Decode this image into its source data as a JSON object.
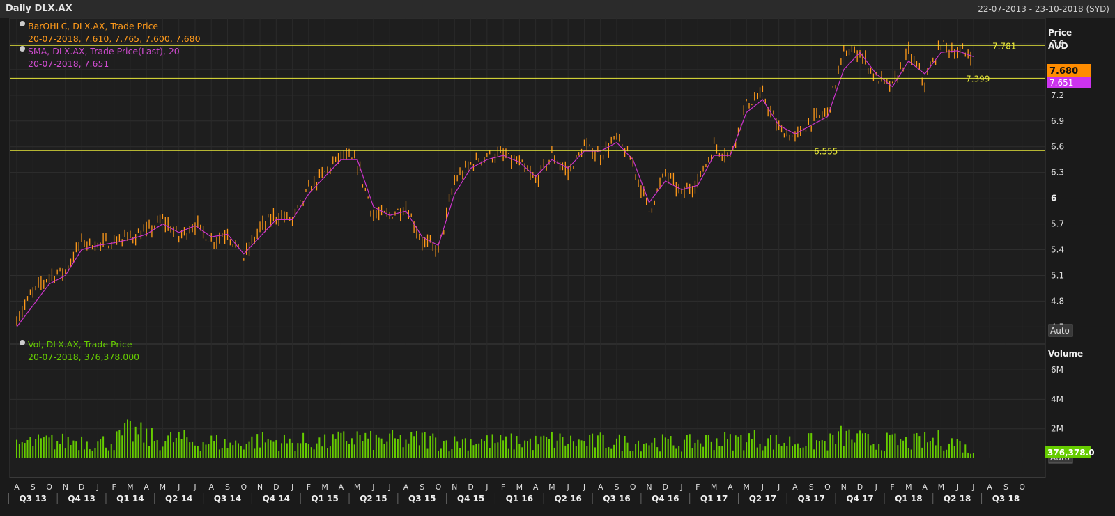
{
  "window": {
    "title": "Daily DLX.AX",
    "date_range": "22-07-2013 - 23-10-2018 (SYD)"
  },
  "price_axis": {
    "label_line1": "Price",
    "label_line2": "AUD",
    "ticks": [
      "7.8",
      "7.5",
      "7.2",
      "6.9",
      "6.6",
      "6.3",
      "6",
      "5.7",
      "5.4",
      "5.1",
      "4.8",
      "4.5"
    ],
    "auto_label": "Auto"
  },
  "volume_axis": {
    "label": "Volume",
    "ticks": [
      "6M",
      "4M",
      "2M"
    ],
    "auto_label": "Auto"
  },
  "legend": {
    "ohlc_title": "BarOHLC, DLX.AX, Trade Price",
    "ohlc_values": "20-07-2018, 7.610, 7.765, 7.600, 7.680",
    "sma_title": "SMA, DLX.AX, Trade Price(Last),  20",
    "sma_values": "20-07-2018, 7.651",
    "vol_title": "Vol, DLX.AX, Trade Price",
    "vol_values": "20-07-2018, 376,378.000"
  },
  "price_tags": {
    "last": "7.680",
    "sma": "7.651",
    "volume": "376,378.0"
  },
  "hlines": [
    {
      "value": 7.781,
      "label": "7.781"
    },
    {
      "value": 7.399,
      "label": "7.399"
    },
    {
      "value": 6.555,
      "label": "6.555"
    }
  ],
  "colors": {
    "ohlc": "#ff9a1a",
    "sma": "#cc33cc",
    "volume": "#66cc00",
    "hline": "#e8e83a",
    "background": "#1e1e1e"
  },
  "chart_data": [
    {
      "type": "line",
      "title": "Daily DLX.AX",
      "ylabel": "Price AUD",
      "ylim": [
        4.3,
        8.1
      ],
      "x": [
        "2013-08-01",
        "2013-09-01",
        "2013-10-01",
        "2013-11-01",
        "2013-12-01",
        "2014-01-01",
        "2014-02-01",
        "2014-03-01",
        "2014-04-01",
        "2014-05-01",
        "2014-06-01",
        "2014-07-01",
        "2014-08-01",
        "2014-09-01",
        "2014-10-01",
        "2014-11-01",
        "2014-12-01",
        "2015-01-01",
        "2015-02-01",
        "2015-03-01",
        "2015-04-01",
        "2015-05-01",
        "2015-06-01",
        "2015-07-01",
        "2015-08-01",
        "2015-09-01",
        "2015-10-01",
        "2015-11-01",
        "2015-12-01",
        "2016-01-01",
        "2016-02-01",
        "2016-03-01",
        "2016-04-01",
        "2016-05-01",
        "2016-06-01",
        "2016-07-01",
        "2016-08-01",
        "2016-09-01",
        "2016-10-01",
        "2016-11-01",
        "2016-12-01",
        "2017-01-01",
        "2017-02-01",
        "2017-03-01",
        "2017-04-01",
        "2017-05-01",
        "2017-06-01",
        "2017-07-01",
        "2017-08-01",
        "2017-09-01",
        "2017-10-01",
        "2017-11-01",
        "2017-12-01",
        "2018-01-01",
        "2018-02-01",
        "2018-03-01",
        "2018-04-01",
        "2018-05-01",
        "2018-06-01",
        "2018-07-01"
      ],
      "series": [
        {
          "name": "BarOHLC, DLX.AX, Trade Price",
          "values": [
            4.6,
            4.9,
            5.1,
            5.15,
            5.5,
            5.45,
            5.5,
            5.55,
            5.6,
            5.75,
            5.55,
            5.7,
            5.5,
            5.6,
            5.3,
            5.65,
            5.8,
            5.75,
            6.1,
            6.3,
            6.5,
            6.4,
            5.8,
            5.8,
            5.9,
            5.5,
            5.4,
            6.2,
            6.4,
            6.5,
            6.5,
            6.4,
            6.2,
            6.5,
            6.3,
            6.6,
            6.5,
            6.7,
            6.4,
            5.85,
            6.3,
            6.05,
            6.2,
            6.6,
            6.5,
            7.1,
            7.2,
            6.8,
            6.7,
            6.9,
            7.0,
            7.7,
            7.7,
            7.4,
            7.3,
            7.7,
            7.35,
            7.8,
            7.7,
            7.68
          ]
        },
        {
          "name": "SMA, DLX.AX, Trade Price(Last),  20",
          "values": [
            4.5,
            4.75,
            5.0,
            5.1,
            5.4,
            5.45,
            5.48,
            5.52,
            5.58,
            5.7,
            5.6,
            5.68,
            5.55,
            5.58,
            5.35,
            5.55,
            5.75,
            5.75,
            6.05,
            6.25,
            6.45,
            6.45,
            5.9,
            5.8,
            5.85,
            5.55,
            5.45,
            6.05,
            6.35,
            6.45,
            6.5,
            6.42,
            6.25,
            6.45,
            6.35,
            6.55,
            6.55,
            6.65,
            6.45,
            5.95,
            6.2,
            6.1,
            6.15,
            6.5,
            6.5,
            7.0,
            7.15,
            6.85,
            6.75,
            6.85,
            6.95,
            7.5,
            7.7,
            7.45,
            7.3,
            7.6,
            7.45,
            7.7,
            7.72,
            7.651
          ]
        }
      ]
    },
    {
      "type": "bar",
      "title": "Vol, DLX.AX, Trade Price",
      "ylabel": "Volume",
      "ylim": [
        0,
        7000000
      ],
      "x": [
        "2013-08-01",
        "2013-09-01",
        "2013-10-01",
        "2013-11-01",
        "2013-12-01",
        "2014-01-01",
        "2014-02-01",
        "2014-03-01",
        "2014-04-01",
        "2014-05-01",
        "2014-06-01",
        "2014-07-01",
        "2014-08-01",
        "2014-09-01",
        "2014-10-01",
        "2014-11-01",
        "2014-12-01",
        "2015-01-01",
        "2015-02-01",
        "2015-03-01",
        "2015-04-01",
        "2015-05-01",
        "2015-06-01",
        "2015-07-01",
        "2015-08-01",
        "2015-09-01",
        "2015-10-01",
        "2015-11-01",
        "2015-12-01",
        "2016-01-01",
        "2016-02-01",
        "2016-03-01",
        "2016-04-01",
        "2016-05-01",
        "2016-06-01",
        "2016-07-01",
        "2016-08-01",
        "2016-09-01",
        "2016-10-01",
        "2016-11-01",
        "2016-12-01",
        "2017-01-01",
        "2017-02-01",
        "2017-03-01",
        "2017-04-01",
        "2017-05-01",
        "2017-06-01",
        "2017-07-01",
        "2017-08-01",
        "2017-09-01",
        "2017-10-01",
        "2017-11-01",
        "2017-12-01",
        "2018-01-01",
        "2018-02-01",
        "2018-03-01",
        "2018-04-01",
        "2018-05-01",
        "2018-06-01",
        "2018-07-01"
      ],
      "series": [
        {
          "name": "Vol, DLX.AX, Trade Price",
          "values": [
            1000000,
            1100000,
            1200000,
            1150000,
            1300000,
            1100000,
            1200000,
            1900000,
            1500000,
            1200000,
            1400000,
            1100000,
            1200000,
            1000000,
            1100000,
            1300000,
            1200000,
            1100000,
            1200000,
            1100000,
            1300000,
            1500000,
            1200000,
            1300000,
            1200000,
            1400000,
            1200000,
            1100000,
            1300000,
            1200000,
            1100000,
            1200000,
            1100000,
            1300000,
            1200000,
            1100000,
            1200000,
            1150000,
            1100000,
            1200000,
            1100000,
            1000000,
            1200000,
            1300000,
            1200000,
            1400000,
            1300000,
            1100000,
            1200000,
            1150000,
            1100000,
            1600000,
            1300000,
            1100000,
            1200000,
            1100000,
            1200000,
            1300000,
            1100000,
            376378
          ]
        }
      ]
    }
  ],
  "x_axis": {
    "months": [
      "A",
      "S",
      "O",
      "N",
      "D",
      "J",
      "F",
      "M",
      "A",
      "M",
      "J",
      "J",
      "A",
      "S",
      "O",
      "N",
      "D",
      "J",
      "F",
      "M",
      "A",
      "M",
      "J",
      "J",
      "A",
      "S",
      "O",
      "N",
      "D",
      "J",
      "F",
      "M",
      "A",
      "M",
      "J",
      "J",
      "A",
      "S",
      "O",
      "N",
      "D",
      "J",
      "F",
      "M",
      "A",
      "M",
      "J",
      "J",
      "A",
      "S",
      "O",
      "N",
      "D",
      "J",
      "F",
      "M",
      "A",
      "M",
      "J",
      "J",
      "A",
      "S",
      "O"
    ],
    "quarters": [
      "Q3 13",
      "Q4 13",
      "Q1 14",
      "Q2 14",
      "Q3 14",
      "Q4 14",
      "Q1 15",
      "Q2 15",
      "Q3 15",
      "Q4 15",
      "Q1 16",
      "Q2 16",
      "Q3 16",
      "Q4 16",
      "Q1 17",
      "Q2 17",
      "Q3 17",
      "Q4 17",
      "Q1 18",
      "Q2 18",
      "Q3 18"
    ]
  }
}
